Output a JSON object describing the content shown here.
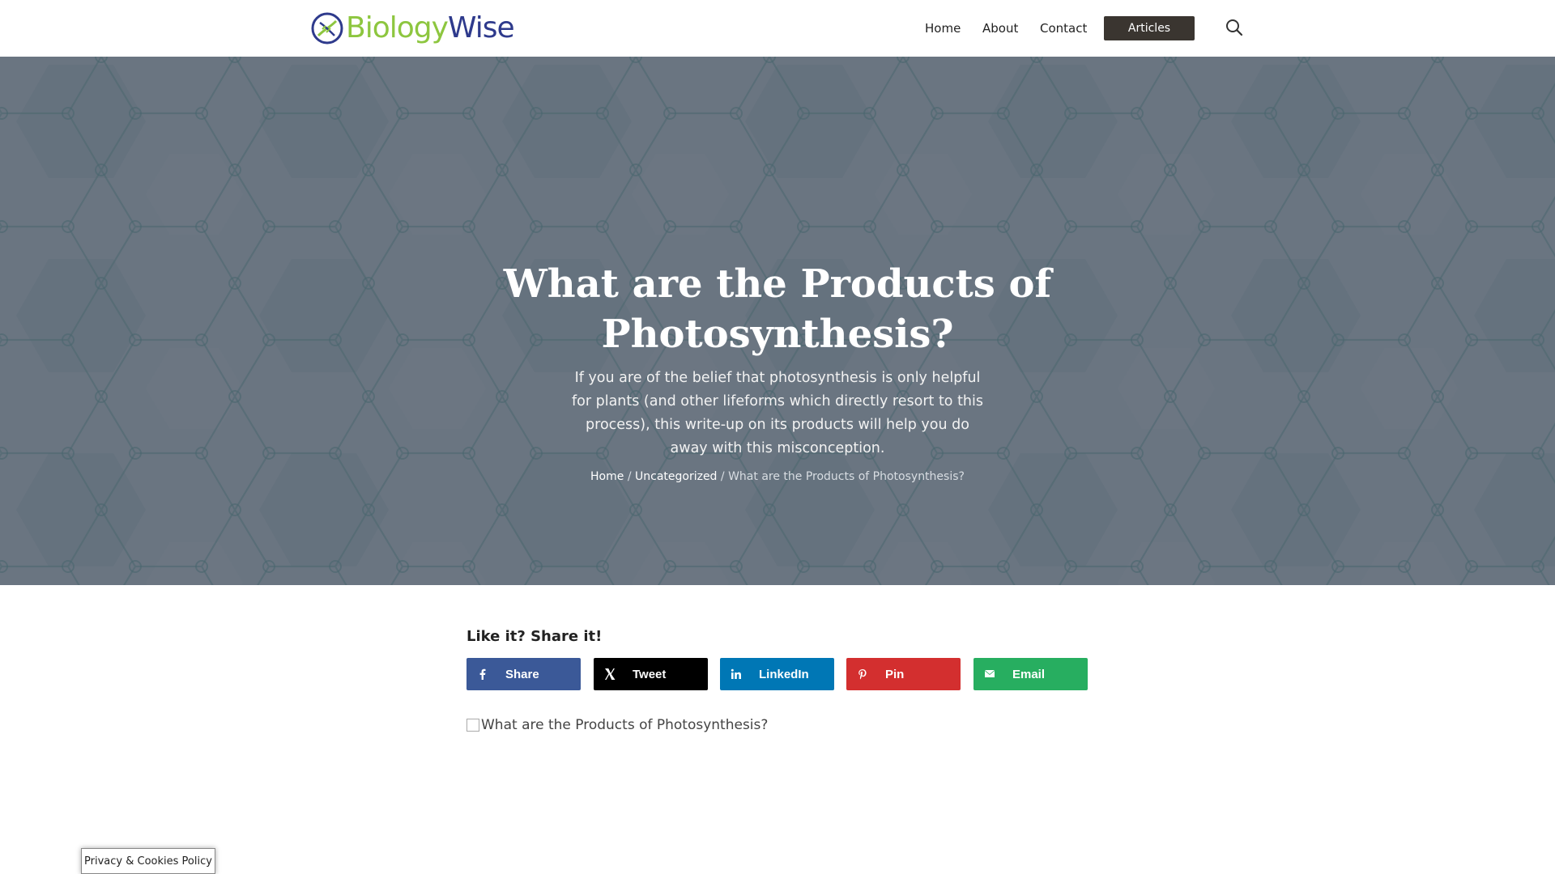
{
  "brand": {
    "logo_text_part1": "Biology",
    "logo_text_part2": "Wise",
    "colors": {
      "green": "#8dc63f",
      "navy": "#2e3a8c"
    }
  },
  "nav": {
    "home": "Home",
    "about": "About",
    "contact": "Contact",
    "articles": "Articles",
    "search_icon": "search-icon"
  },
  "hero": {
    "title": "What are the Products of Photosynthesis?",
    "description": "If you are of the belief that photosynthesis is only helpful for plants (and other lifeforms which directly resort to this process), this write-up on its products will help you do away with this misconception.",
    "breadcrumb": {
      "home": "Home",
      "category": "Uncategorized",
      "current": "What are the Products of Photosynthesis?",
      "separator": "/"
    }
  },
  "share": {
    "title": "Like it? Share it!",
    "buttons": [
      {
        "label": "Share",
        "icon": "facebook-icon",
        "color": "#3b5998"
      },
      {
        "label": "Tweet",
        "icon": "x-icon",
        "color": "#000000"
      },
      {
        "label": "LinkedIn",
        "icon": "linkedin-icon",
        "color": "#0077b5"
      },
      {
        "label": "Pin",
        "icon": "pinterest-icon",
        "color": "#d32f2f"
      },
      {
        "label": "Email",
        "icon": "email-icon",
        "color": "#27ae60"
      }
    ]
  },
  "article_image_alt": "What are the Products of Photosynthesis?",
  "privacy_label": "Privacy & Cookies Policy"
}
